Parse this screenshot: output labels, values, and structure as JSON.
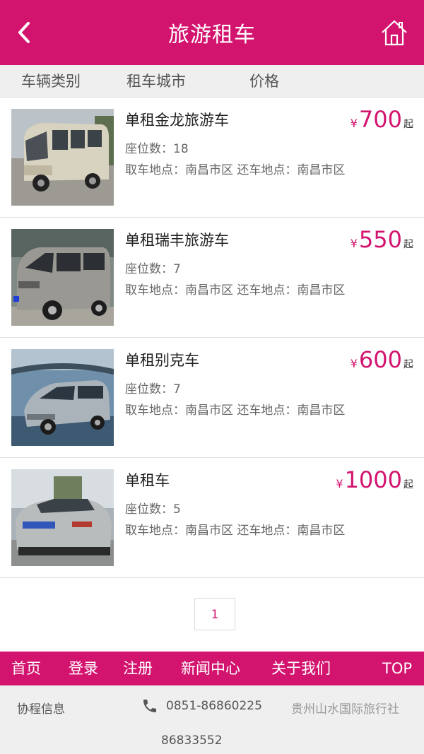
{
  "header": {
    "title": "旅游租车",
    "back_icon": "back-arrow-icon",
    "home_icon": "home-icon"
  },
  "filters": [
    "车辆类别",
    "租车城市",
    "价格"
  ],
  "cars": [
    {
      "name": "单租金龙旅游车",
      "seats": "座位数：18",
      "locations": "取车地点：南昌市区 还车地点：南昌市区",
      "currency": "¥",
      "price": "700",
      "price_suffix": "起",
      "image": "minibus-photo"
    },
    {
      "name": "单租瑞丰旅游车",
      "seats": "座位数：7",
      "locations": "取车地点：南昌市区 还车地点：南昌市区",
      "currency": "¥",
      "price": "550",
      "price_suffix": "起",
      "image": "van-photo"
    },
    {
      "name": "单租别克车",
      "seats": "座位数：7",
      "locations": "取车地点：南昌市区 还车地点：南昌市区",
      "currency": "¥",
      "price": "600",
      "price_suffix": "起",
      "image": "mpv-photo"
    },
    {
      "name": "单租车",
      "seats": "座位数：5",
      "locations": "取车地点：南昌市区 还车地点：南昌市区",
      "currency": "¥",
      "price": "1000",
      "price_suffix": "起",
      "image": "sedan-photo"
    }
  ],
  "pagination": {
    "current": "1"
  },
  "bottom_nav": [
    "首页",
    "登录",
    "注册",
    "新闻中心",
    "关于我们",
    "TOP"
  ],
  "footer": {
    "left": "协程信息",
    "phone": "0851-86860225",
    "company": "贵州山水国际旅行社",
    "phone2": "86833552"
  },
  "colors": {
    "brand": "#d3146f",
    "filter_bg": "#efefef",
    "footer_bg": "#efefef"
  }
}
